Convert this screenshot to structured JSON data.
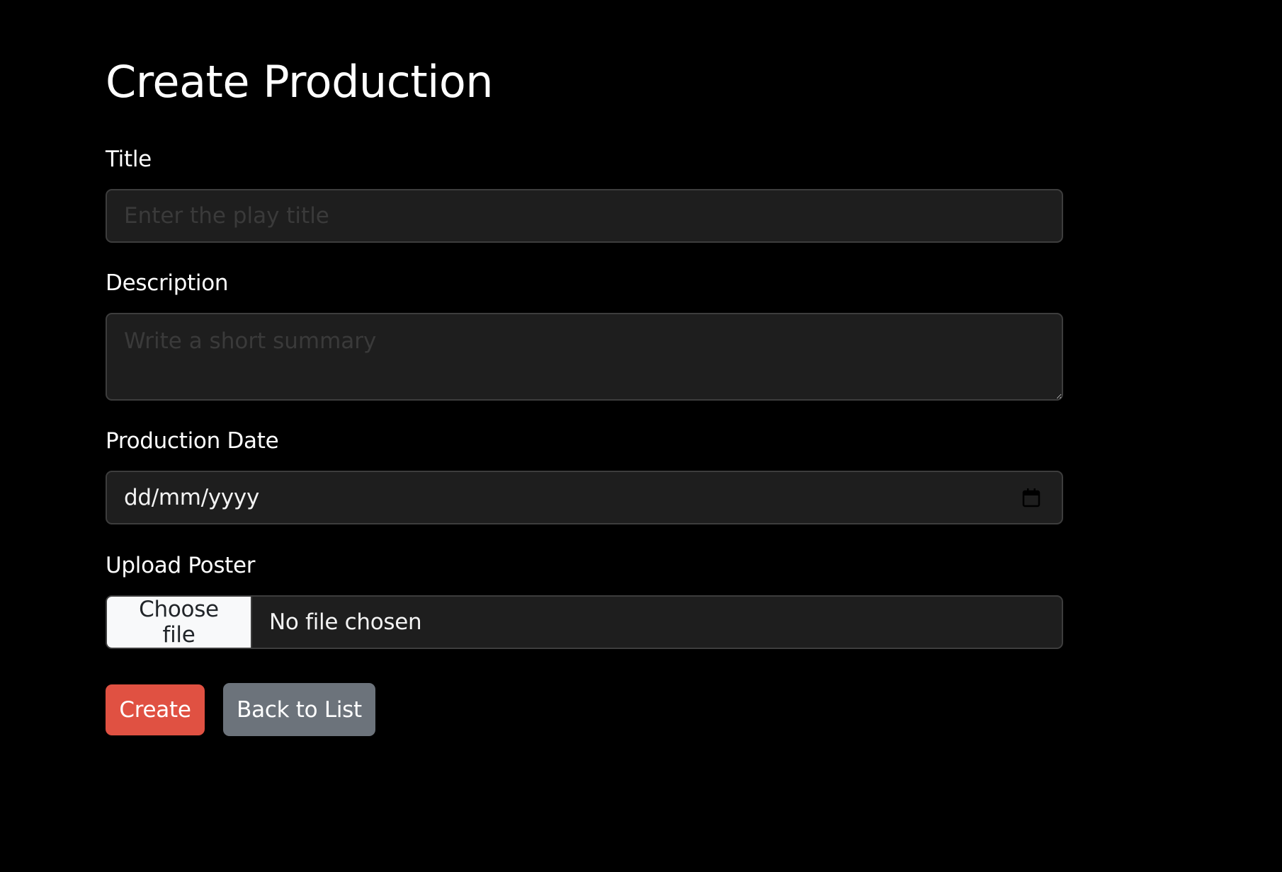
{
  "page": {
    "title": "Create Production"
  },
  "form": {
    "title_field": {
      "label": "Title",
      "value": "",
      "placeholder": "Enter the play title"
    },
    "description_field": {
      "label": "Description",
      "value": "",
      "placeholder": "Write a short summary"
    },
    "date_field": {
      "label": "Production Date",
      "display_value": "dd/mm/yyyy",
      "icon": "calendar-icon"
    },
    "poster_field": {
      "label": "Upload Poster",
      "button_label": "Choose file",
      "status": "No file chosen"
    }
  },
  "actions": {
    "create_label": "Create",
    "back_label": "Back to List"
  },
  "colors": {
    "background": "#000000",
    "input_background": "#1e1e1e",
    "create_button": "#e05142",
    "back_button": "#6c737b"
  }
}
